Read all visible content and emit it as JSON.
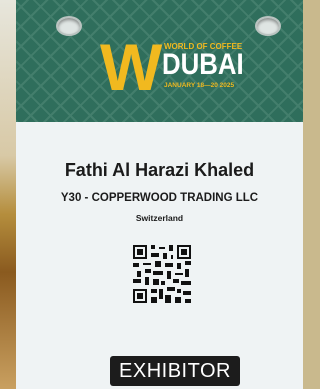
{
  "event": {
    "logo_letter": "W",
    "logo_top": "WORLD OF COFFEE",
    "logo_city": "DUBAI",
    "logo_dates": "JANUARY 18—20 2025"
  },
  "attendee": {
    "name": "Fathi Al Harazi Khaled",
    "company": "Y30 - COPPERWOOD TRADING LLC",
    "country": "Switzerland"
  },
  "badge_type": "EXHIBITOR",
  "colors": {
    "header": "#2f6e5c",
    "logo_gold": "#f1b91f",
    "badge_bg": "#eff3f4",
    "footer_bg": "#1c1c1c"
  }
}
